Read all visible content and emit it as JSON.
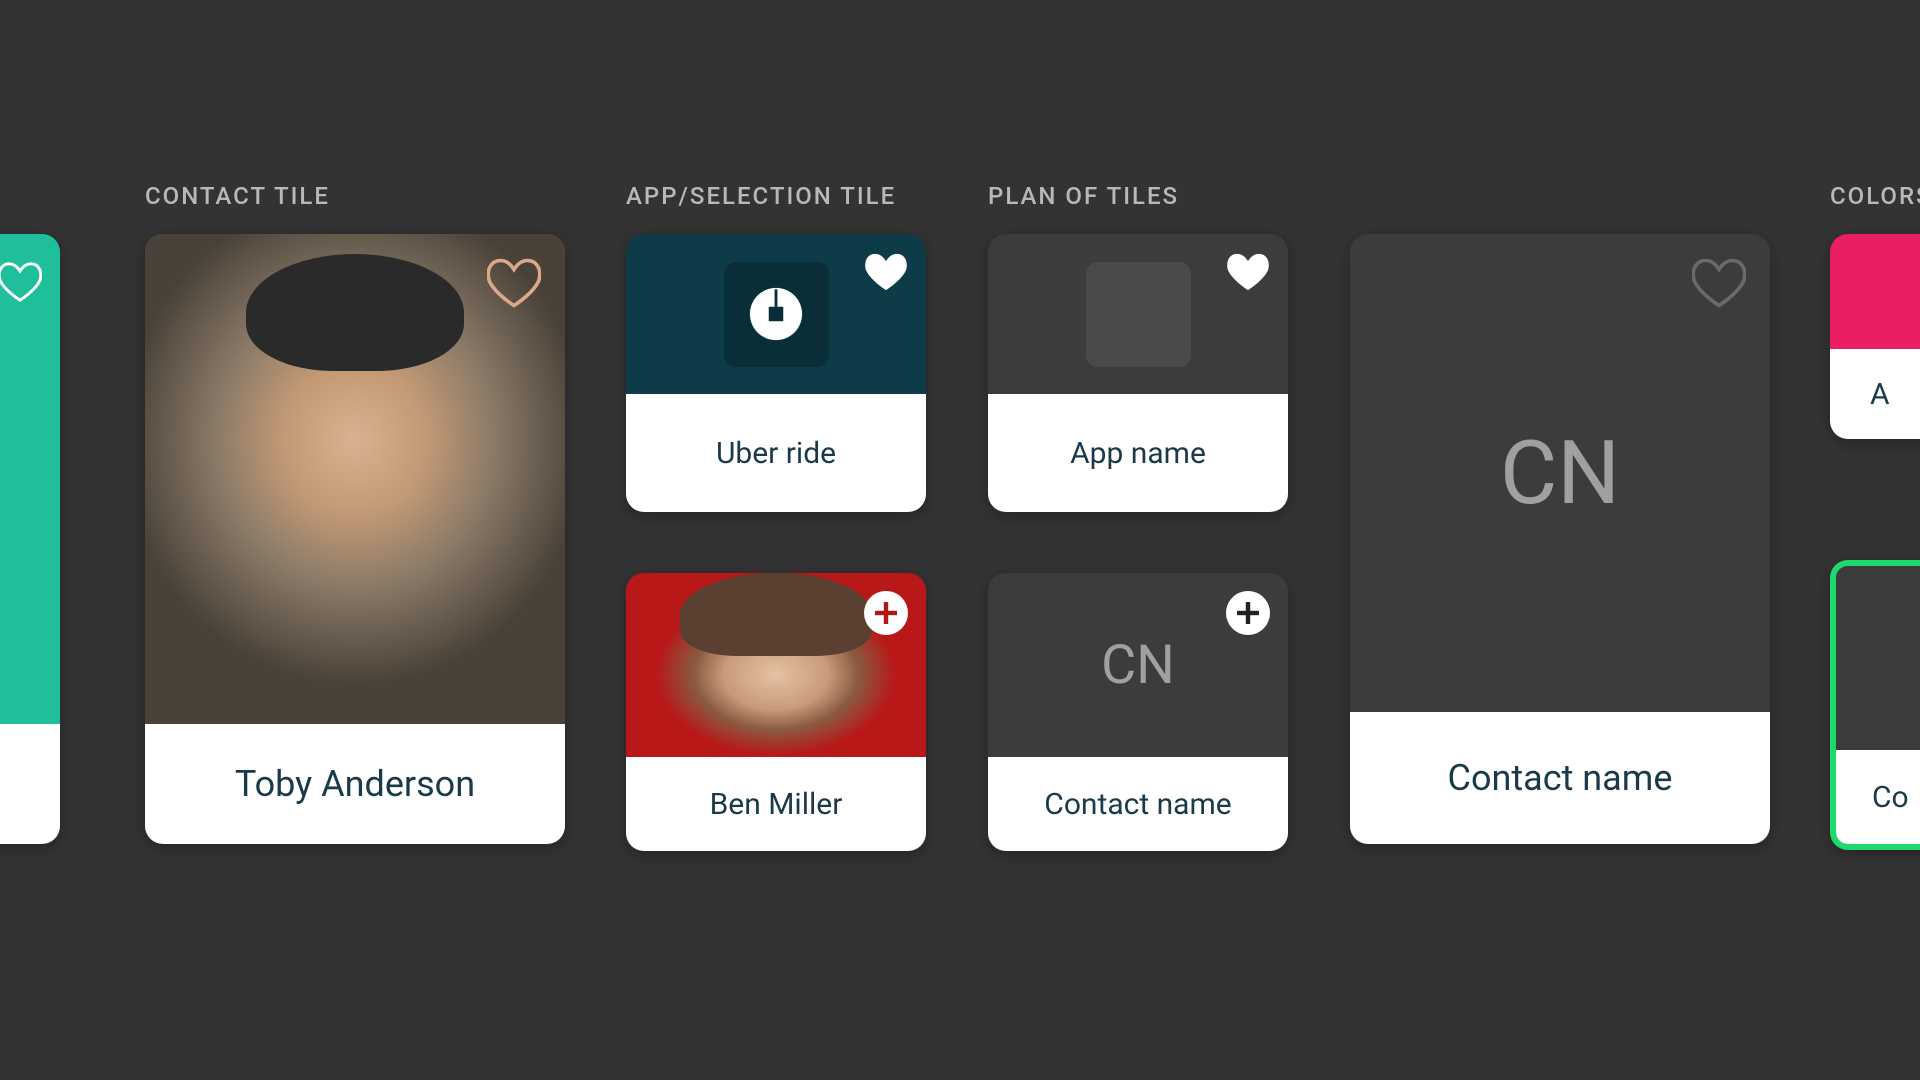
{
  "sections": {
    "contact_tile": "CONTACT TILE",
    "app_selection_tile": "APP/SELECTION TILE",
    "plan_of_tiles": "PLAN OF TILES",
    "colors": "COLORS"
  },
  "left_partial": {
    "favorite": true
  },
  "contact_large": {
    "name": "Toby Anderson",
    "favorite": false
  },
  "app_tile": {
    "name": "Uber ride",
    "icon": "uber-icon",
    "favorite": true
  },
  "selection_tile": {
    "name": "Ben Miller",
    "action": "add"
  },
  "plan": {
    "app": {
      "label": "App name",
      "favorite": true
    },
    "contact_small": {
      "initials": "CN",
      "label": "Contact name",
      "action": "add"
    },
    "contact_large": {
      "initials": "CN",
      "label": "Contact name",
      "favorite": false
    }
  },
  "colors_partials": {
    "a": {
      "label_fragment": "A"
    },
    "b": {
      "label_fragment": "Co"
    }
  }
}
